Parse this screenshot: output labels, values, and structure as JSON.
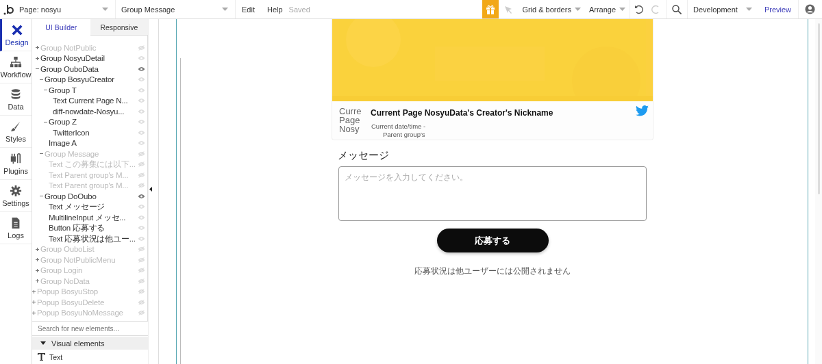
{
  "topbar": {
    "page_selector": "Page: nosyu",
    "element_selector": "Group Message",
    "menus": [
      "Edit",
      "Help"
    ],
    "save_status": "Saved",
    "grid_menu": "Grid & borders",
    "arrange_menu": "Arrange",
    "redo_disabled": true,
    "environment": "Development",
    "preview": "Preview"
  },
  "rail": [
    {
      "label": "Design",
      "selected": true
    },
    {
      "label": "Workflow",
      "selected": false
    },
    {
      "label": "Data",
      "selected": false
    },
    {
      "label": "Styles",
      "selected": false
    },
    {
      "label": "Plugins",
      "selected": false
    },
    {
      "label": "Settings",
      "selected": false
    },
    {
      "label": "Logs",
      "selected": false
    }
  ],
  "panel": {
    "tabs": [
      {
        "label": "UI Builder",
        "selected": true
      },
      {
        "label": "Responsive",
        "selected": false
      }
    ],
    "tree": [
      {
        "kind": "group",
        "label": "Group NotPublic",
        "expanded": false,
        "hidden": true,
        "highlighted": false
      },
      {
        "kind": "group",
        "label": "Group NosyuDetail",
        "expanded": false,
        "hidden": false,
        "highlighted": false
      },
      {
        "kind": "group",
        "label": "Group OuboData",
        "expanded": true,
        "hidden": false,
        "highlighted": true,
        "children": [
          {
            "kind": "group",
            "label": "Group BosyuCreator",
            "expanded": true,
            "hidden": false,
            "highlighted": false,
            "children": [
              {
                "kind": "group",
                "label": "Group T",
                "expanded": true,
                "hidden": false,
                "highlighted": false,
                "children": [
                  {
                    "kind": "element",
                    "label": "Text Current Page N...",
                    "hidden": false,
                    "highlighted": false
                  },
                  {
                    "kind": "element",
                    "label": "diff-nowdate-Nosyu...",
                    "hidden": false,
                    "highlighted": false
                  }
                ]
              },
              {
                "kind": "group",
                "label": "Group Z",
                "expanded": true,
                "hidden": false,
                "highlighted": false,
                "children": [
                  {
                    "kind": "element",
                    "label": "TwitterIcon",
                    "hidden": false,
                    "highlighted": false
                  }
                ]
              },
              {
                "kind": "element",
                "label": "Image A",
                "hidden": false,
                "highlighted": false
              }
            ]
          },
          {
            "kind": "group",
            "label": "Group Message",
            "expanded": true,
            "hidden": true,
            "highlighted": false,
            "children": [
              {
                "kind": "element",
                "label": "Text この募集には以下...",
                "hidden": true,
                "highlighted": false
              },
              {
                "kind": "element",
                "label": "Text Parent group's M...",
                "hidden": true,
                "highlighted": false
              },
              {
                "kind": "element",
                "label": "Text Parent group's M...",
                "hidden": true,
                "highlighted": false
              }
            ]
          },
          {
            "kind": "group",
            "label": "Group DoOubo",
            "expanded": true,
            "hidden": false,
            "highlighted": true,
            "children": [
              {
                "kind": "element",
                "label": "Text メッセージ",
                "hidden": false,
                "highlighted": false
              },
              {
                "kind": "element",
                "label": "MultilineInput メッセ...",
                "hidden": false,
                "highlighted": false
              },
              {
                "kind": "element",
                "label": "Button 応募する",
                "hidden": false,
                "highlighted": false
              },
              {
                "kind": "element",
                "label": "Text 応募状況は他ユー...",
                "hidden": false,
                "highlighted": false
              }
            ]
          }
        ]
      },
      {
        "kind": "group",
        "label": "Group OuboList",
        "expanded": false,
        "hidden": true,
        "highlighted": false
      },
      {
        "kind": "group",
        "label": "Group NotPublicMenu",
        "expanded": false,
        "hidden": true,
        "highlighted": false
      },
      {
        "kind": "group",
        "label": "Group Login",
        "expanded": false,
        "hidden": true,
        "highlighted": false
      },
      {
        "kind": "group",
        "label": "Group NoData",
        "expanded": false,
        "hidden": true,
        "highlighted": false
      },
      {
        "kind": "popup",
        "label": "Popup BosyuStop",
        "expanded": false,
        "hidden": true,
        "highlighted": false
      },
      {
        "kind": "popup",
        "label": "Popup BosyuDelete",
        "expanded": false,
        "hidden": true,
        "highlighted": false
      },
      {
        "kind": "popup",
        "label": "Popup BosyuNoMessage",
        "expanded": false,
        "hidden": true,
        "highlighted": false
      }
    ],
    "search": {
      "placeholder": "Search for new elements..."
    },
    "category": {
      "label": "Visual elements",
      "expanded": true
    },
    "elements": [
      "Text"
    ]
  },
  "canvas": {
    "card": {
      "alt_text": [
        "Curre",
        "Page",
        "Nosy"
      ],
      "title": "Current Page NosyuData's Creator's Nickname",
      "lines": [
        "Current date/time -",
        "Parent group's"
      ]
    },
    "message_label": "メッセージ",
    "message_field": {
      "placeholder": "メッセージを入力してください。"
    },
    "submit_button": "応募する",
    "note": "応募状況は他ユーザーには公開されません"
  }
}
